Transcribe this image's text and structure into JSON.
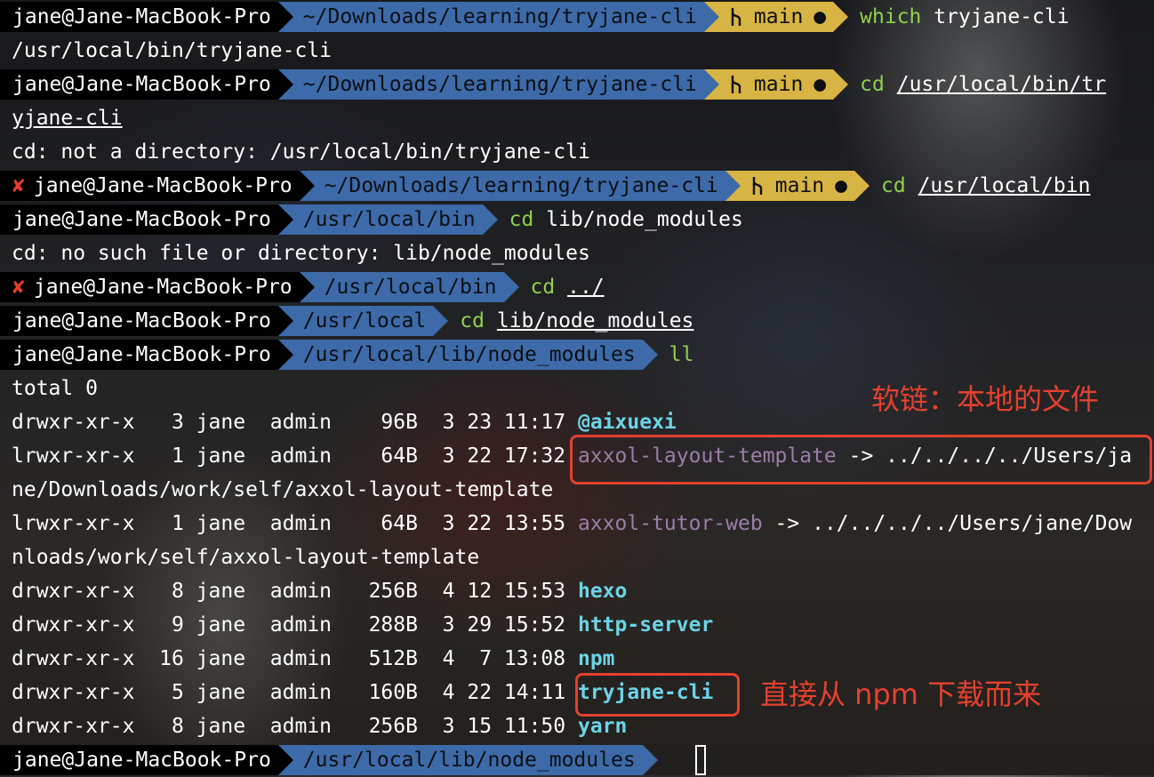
{
  "prompt": {
    "context": "jane@Jane-MacBook-Pro",
    "error_mark": "✘",
    "branch_icon": "git-branch-icon",
    "dirty_mark": "●"
  },
  "lines": {
    "l1": {
      "dir": "~/Downloads/learning/tryjane-cli",
      "branch": "main",
      "cmd": "which",
      "arg": "tryjane-cli"
    },
    "l2": {
      "text": "/usr/local/bin/tryjane-cli"
    },
    "l3": {
      "dir": "~/Downloads/learning/tryjane-cli",
      "branch": "main",
      "cmd": "cd",
      "arg": "/usr/local/bin/tr"
    },
    "l4": {
      "text": "yjane-cli"
    },
    "l5": {
      "text": "cd: not a directory: /usr/local/bin/tryjane-cli"
    },
    "l6": {
      "dir": "~/Downloads/learning/tryjane-cli",
      "branch": "main",
      "cmd": "cd",
      "arg": "/usr/local/bin"
    },
    "l7": {
      "dir": "/usr/local/bin",
      "cmd": "cd",
      "arg": "lib/node_modules"
    },
    "l8": {
      "text": "cd: no such file or directory: lib/node_modules"
    },
    "l9": {
      "dir": "/usr/local/bin",
      "cmd": "cd",
      "arg": "../"
    },
    "l10": {
      "dir": "/usr/local",
      "cmd": "cd",
      "arg": "lib/node_modules"
    },
    "l11": {
      "dir": "/usr/local/lib/node_modules",
      "cmd": "ll"
    },
    "l12": {
      "text": "total 0"
    },
    "l23": {
      "dir": "/usr/local/lib/node_modules"
    }
  },
  "listing": [
    {
      "info": "drwxr-xr-x   3 jane  admin    96B  3 23 11:17 ",
      "name": "@aixuexi",
      "kind": "dir"
    },
    {
      "info": "lrwxr-xr-x   1 jane  admin    64B  3 22 17:32 ",
      "name": "axxol-layout-template",
      "kind": "link",
      "target": " -> ../../../../Users/ja",
      "wrap": "ne/Downloads/work/self/axxol-layout-template"
    },
    {
      "info": "lrwxr-xr-x   1 jane  admin    64B  3 22 13:55 ",
      "name": "axxol-tutor-web",
      "kind": "link",
      "target": " -> ../../../../Users/jane/Dow",
      "wrap": "nloads/work/self/axxol-layout-template"
    },
    {
      "info": "drwxr-xr-x   8 jane  admin   256B  4 12 15:53 ",
      "name": "hexo",
      "kind": "dir"
    },
    {
      "info": "drwxr-xr-x   9 jane  admin   288B  3 29 15:52 ",
      "name": "http-server",
      "kind": "dir"
    },
    {
      "info": "drwxr-xr-x  16 jane  admin   512B  4  7 13:08 ",
      "name": "npm",
      "kind": "dir"
    },
    {
      "info": "drwxr-xr-x   5 jane  admin   160B  4 22 14:11 ",
      "name": "tryjane-cli",
      "kind": "dir"
    },
    {
      "info": "drwxr-xr-x   8 jane  admin   256B  3 15 11:50 ",
      "name": "yarn",
      "kind": "dir"
    }
  ],
  "annotations": {
    "symlink_note": "软链：本地的文件",
    "npm_note": "直接从 npm 下载而来"
  },
  "colors": {
    "prompt_dir_bg": "#3d6aa8",
    "prompt_git_bg": "#d7b443",
    "command": "#8fd14f",
    "directory": "#6cd3e6",
    "symlink": "#9a7ea9",
    "annotation": "#e4412e",
    "error": "#e53e2e"
  }
}
